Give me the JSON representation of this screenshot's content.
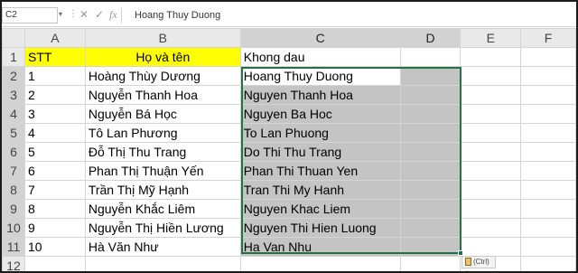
{
  "formula_bar": {
    "name_box": "C2",
    "cancel_glyph": "✕",
    "enter_glyph": "✓",
    "fx_glyph": "fx",
    "formula_value": "Hoang Thuy Duong"
  },
  "columns": [
    "A",
    "B",
    "C",
    "D",
    "E",
    "F"
  ],
  "rows": [
    {
      "num": "1",
      "a": "STT",
      "b": "Họ và tên",
      "c": "Khong dau"
    },
    {
      "num": "2",
      "a": "1",
      "b": "Hoàng Thùy Dương",
      "c": "Hoang Thuy Duong"
    },
    {
      "num": "3",
      "a": "2",
      "b": "Nguyễn Thanh Hoa",
      "c": "Nguyen Thanh Hoa"
    },
    {
      "num": "4",
      "a": "3",
      "b": "Nguyễn Bá Học",
      "c": "Nguyen Ba Hoc"
    },
    {
      "num": "5",
      "a": "4",
      "b": "Tô Lan Phương",
      "c": "To Lan Phuong"
    },
    {
      "num": "6",
      "a": "5",
      "b": "Đỗ Thị Thu Trang",
      "c": "Do Thi Thu Trang"
    },
    {
      "num": "7",
      "a": "6",
      "b": "Phan Thị Thuận Yến",
      "c": "Phan Thi Thuan Yen"
    },
    {
      "num": "8",
      "a": "7",
      "b": "Trần Thị Mỹ Hạnh",
      "c": "Tran Thi My Hanh"
    },
    {
      "num": "9",
      "a": "8",
      "b": "Nguyễn Khắc Liêm",
      "c": "Nguyen Khac Liem"
    },
    {
      "num": "10",
      "a": "9",
      "b": "Nguyễn Thị Hiền Lương",
      "c": "Nguyen Thi Hien Luong"
    },
    {
      "num": "11",
      "a": "10",
      "b": "Hà Văn Như",
      "c": "Ha Van Nhu"
    },
    {
      "num": "12",
      "a": "",
      "b": "",
      "c": ""
    }
  ],
  "paste_options": {
    "label": "(Ctrl)",
    "icon": "clipboard-icon",
    "arrow": "▾"
  },
  "colors": {
    "header_fill": "#ffff00",
    "selection_fill": "#c4c4c4",
    "selection_border": "#217346"
  }
}
